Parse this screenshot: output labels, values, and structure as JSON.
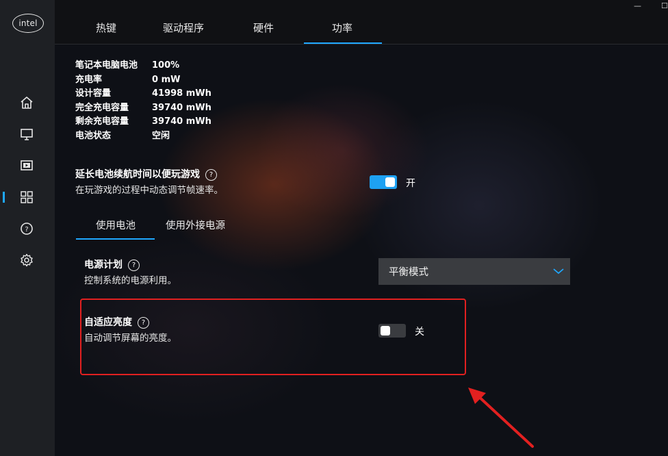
{
  "app": {
    "logo_text": "intel"
  },
  "window": {
    "minimize_label": "—",
    "maximize_label": "☐"
  },
  "tabs": [
    {
      "label": "热键"
    },
    {
      "label": "驱动程序"
    },
    {
      "label": "硬件"
    },
    {
      "label": "功率",
      "active": true
    }
  ],
  "sidebar": {
    "items": [
      {
        "icon": "home-icon"
      },
      {
        "icon": "display-icon"
      },
      {
        "icon": "video-icon"
      },
      {
        "icon": "apps-grid-icon",
        "active": true
      },
      {
        "icon": "help-icon"
      },
      {
        "icon": "gear-icon"
      }
    ]
  },
  "battery_info": [
    {
      "key": "笔记本电脑电池",
      "value": "100%"
    },
    {
      "key": "充电率",
      "value": "0 mW"
    },
    {
      "key": "设计容量",
      "value": "41998 mWh"
    },
    {
      "key": "完全充电容量",
      "value": "39740 mWh"
    },
    {
      "key": "剩余充电容量",
      "value": "39740 mWh"
    },
    {
      "key": "电池状态",
      "value": "空闲"
    }
  ],
  "extend_battery": {
    "title": "延长电池续航时间以便玩游戏",
    "help": "?",
    "description": "在玩游戏的过程中动态调节帧速率。",
    "toggle_state": "on",
    "toggle_label": "开"
  },
  "power_subtabs": [
    {
      "label": "使用电池",
      "active": true
    },
    {
      "label": "使用外接电源"
    }
  ],
  "power_plan": {
    "title": "电源计划",
    "help": "?",
    "description": "控制系统的电源利用。",
    "selected": "平衡模式"
  },
  "adaptive_brightness": {
    "title": "自适应亮度",
    "help": "?",
    "description": "自动调节屏幕的亮度。",
    "toggle_state": "off",
    "toggle_label": "关"
  },
  "colors": {
    "accent": "#1fa8ff",
    "highlight": "#e22020",
    "sidebar": "#1e2024"
  }
}
